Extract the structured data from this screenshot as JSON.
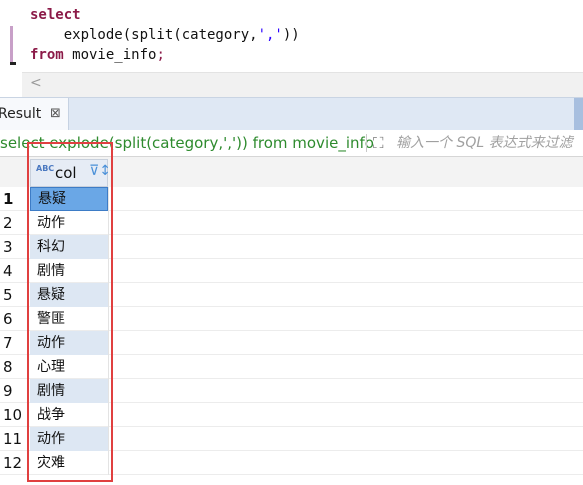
{
  "editor": {
    "line1_kw": "select",
    "line2_fn": "    explode(split(category,",
    "line2_str": "','",
    "line2_end": "))",
    "line3_kw": "from",
    "line3_table": " movie_info",
    "line3_semi": ";",
    "scroll_left": "<"
  },
  "result_tab": {
    "label": "Result",
    "close": "⊠"
  },
  "filter": {
    "query": "select explode(split(category,',')) from movie_info",
    "placeholder": "输入一个 SQL 表达式来过滤"
  },
  "grid": {
    "column": "col",
    "type_icon": "ABC",
    "rows": [
      {
        "num": "1",
        "value": "悬疑"
      },
      {
        "num": "2",
        "value": "动作"
      },
      {
        "num": "3",
        "value": "科幻"
      },
      {
        "num": "4",
        "value": "剧情"
      },
      {
        "num": "5",
        "value": "悬疑"
      },
      {
        "num": "6",
        "value": "警匪"
      },
      {
        "num": "7",
        "value": "动作"
      },
      {
        "num": "8",
        "value": "心理"
      },
      {
        "num": "9",
        "value": "剧情"
      },
      {
        "num": "10",
        "value": "战争"
      },
      {
        "num": "11",
        "value": "动作"
      },
      {
        "num": "12",
        "value": "灾难"
      }
    ]
  },
  "colors": {
    "keyword": "#8b1a48",
    "string": "#2a00ff",
    "query_text": "#2e8b2e",
    "selected_cell": "#6aa7e6",
    "alt_row": "#dde7f3",
    "highlight_box": "#e04040"
  }
}
